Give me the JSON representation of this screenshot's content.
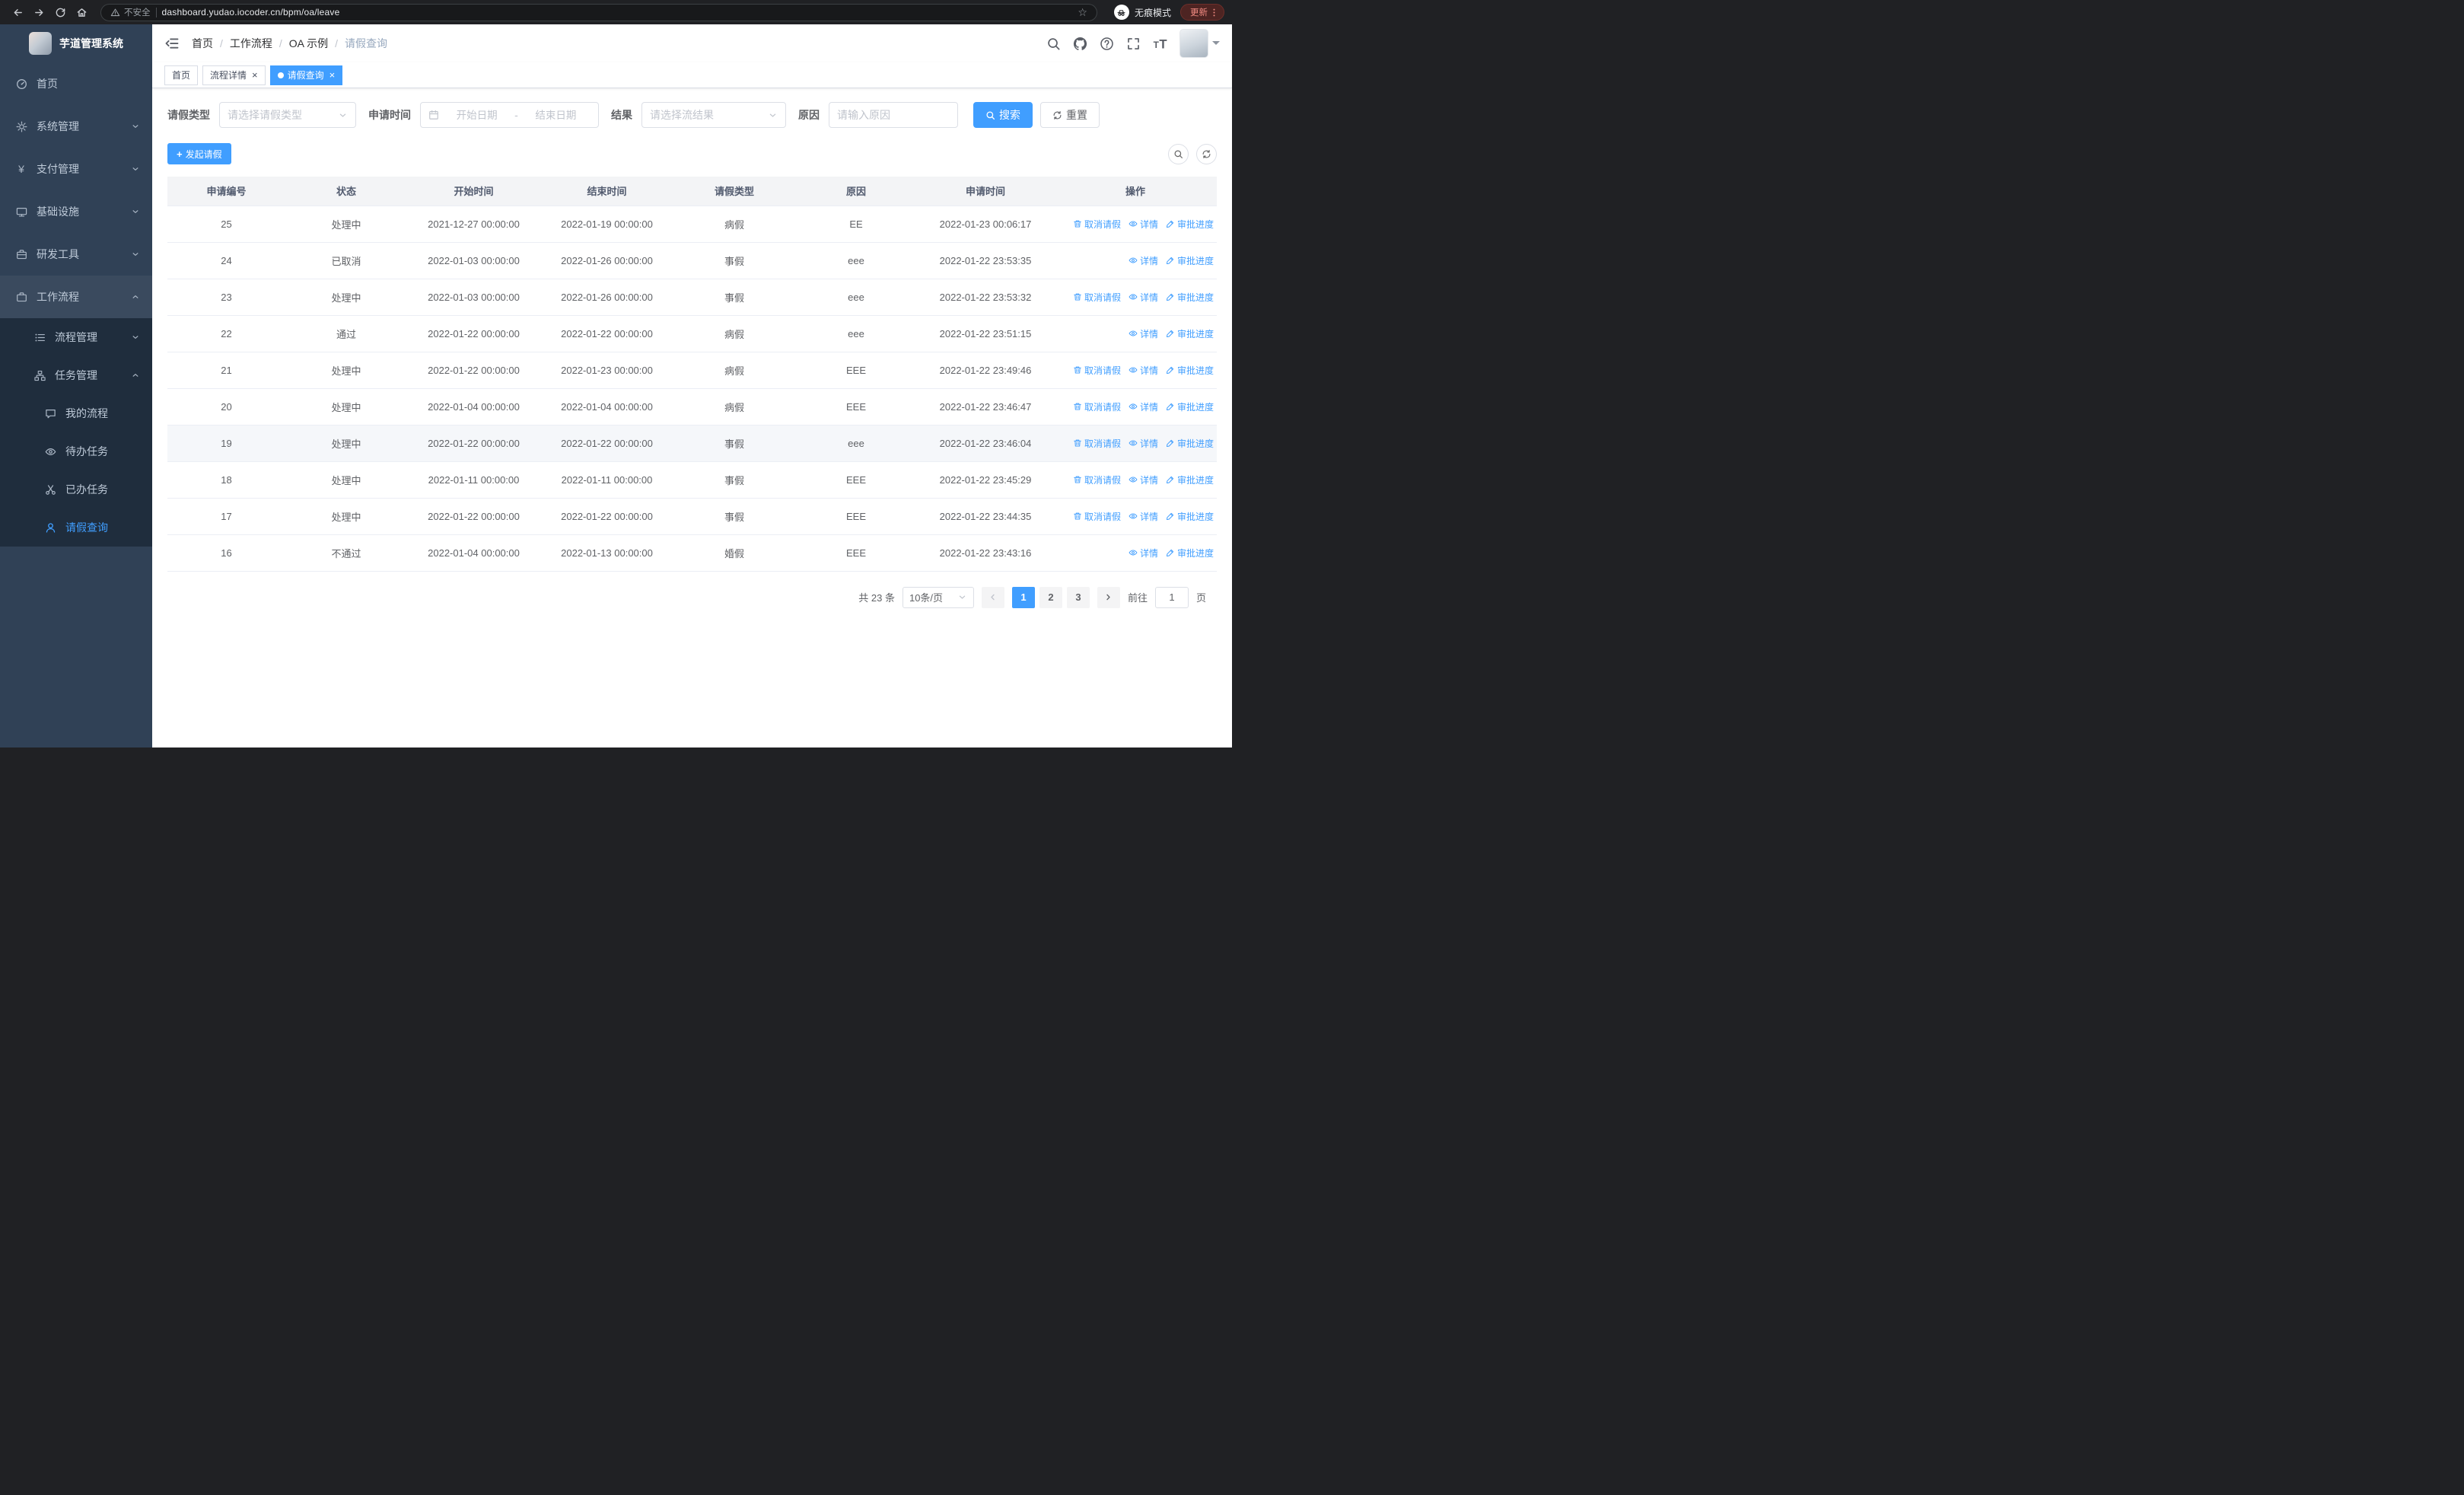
{
  "browser": {
    "security_warning": "不安全",
    "url": "dashboard.yudao.iocoder.cn/bpm/oa/leave",
    "incognito_label": "无痕模式",
    "update_button": "更新"
  },
  "icons": {
    "close": "×",
    "plus": "+",
    "star": "☆",
    "yen": "¥"
  },
  "sidebar": {
    "logo_title": "芋道管理系统",
    "items": [
      {
        "label": "首页",
        "icon": "dashboard-icon"
      },
      {
        "label": "系统管理",
        "icon": "gear-icon"
      },
      {
        "label": "支付管理",
        "icon": "yen-icon"
      },
      {
        "label": "基础设施",
        "icon": "monitor-icon"
      },
      {
        "label": "研发工具",
        "icon": "briefcase-icon"
      },
      {
        "label": "工作流程",
        "icon": "workflow-icon",
        "expanded": true
      }
    ],
    "workflow_children": [
      {
        "label": "流程管理",
        "icon": "list-icon"
      },
      {
        "label": "任务管理",
        "icon": "tree-icon",
        "expanded": true
      }
    ],
    "task_children": [
      {
        "label": "我的流程",
        "icon": "message-icon"
      },
      {
        "label": "待办任务",
        "icon": "eye-icon"
      },
      {
        "label": "已办任务",
        "icon": "scissors-icon"
      },
      {
        "label": "请假查询",
        "icon": "user-icon",
        "active": true
      }
    ]
  },
  "header": {
    "breadcrumb": [
      "首页",
      "工作流程",
      "OA 示例",
      "请假查询"
    ],
    "crumb_separator": "/",
    "icons": [
      "search-icon",
      "github-icon",
      "help-icon",
      "fullscreen-icon",
      "font-size-icon"
    ]
  },
  "tabs": [
    {
      "label": "首页",
      "closable": false,
      "active": false
    },
    {
      "label": "流程详情",
      "closable": true,
      "active": false
    },
    {
      "label": "请假查询",
      "closable": true,
      "active": true
    }
  ],
  "filters": {
    "leave_type_label": "请假类型",
    "leave_type_placeholder": "请选择请假类型",
    "apply_time_label": "申请时间",
    "start_date_placeholder": "开始日期",
    "date_separator": "-",
    "end_date_placeholder": "结束日期",
    "result_label": "结果",
    "result_placeholder": "请选择流结果",
    "reason_label": "原因",
    "reason_placeholder": "请输入原因",
    "search_button": "搜索",
    "reset_button": "重置"
  },
  "toolbar": {
    "create_button": "发起请假"
  },
  "table": {
    "columns": [
      "申请编号",
      "状态",
      "开始时间",
      "结束时间",
      "请假类型",
      "原因",
      "申请时间",
      "操作"
    ],
    "action_cancel": "取消请假",
    "action_detail": "详情",
    "action_progress": "审批进度",
    "rows": [
      {
        "id": "25",
        "status": "处理中",
        "start": "2021-12-27 00:00:00",
        "end": "2022-01-19 00:00:00",
        "type": "病假",
        "reason": "EE",
        "apply_time": "2022-01-23 00:06:17",
        "cancellable": true
      },
      {
        "id": "24",
        "status": "已取消",
        "start": "2022-01-03 00:00:00",
        "end": "2022-01-26 00:00:00",
        "type": "事假",
        "reason": "eee",
        "apply_time": "2022-01-22 23:53:35",
        "cancellable": false
      },
      {
        "id": "23",
        "status": "处理中",
        "start": "2022-01-03 00:00:00",
        "end": "2022-01-26 00:00:00",
        "type": "事假",
        "reason": "eee",
        "apply_time": "2022-01-22 23:53:32",
        "cancellable": true
      },
      {
        "id": "22",
        "status": "通过",
        "start": "2022-01-22 00:00:00",
        "end": "2022-01-22 00:00:00",
        "type": "病假",
        "reason": "eee",
        "apply_time": "2022-01-22 23:51:15",
        "cancellable": false
      },
      {
        "id": "21",
        "status": "处理中",
        "start": "2022-01-22 00:00:00",
        "end": "2022-01-23 00:00:00",
        "type": "病假",
        "reason": "EEE",
        "apply_time": "2022-01-22 23:49:46",
        "cancellable": true
      },
      {
        "id": "20",
        "status": "处理中",
        "start": "2022-01-04 00:00:00",
        "end": "2022-01-04 00:00:00",
        "type": "病假",
        "reason": "EEE",
        "apply_time": "2022-01-22 23:46:47",
        "cancellable": true
      },
      {
        "id": "19",
        "status": "处理中",
        "start": "2022-01-22 00:00:00",
        "end": "2022-01-22 00:00:00",
        "type": "事假",
        "reason": "eee",
        "apply_time": "2022-01-22 23:46:04",
        "cancellable": true,
        "hover": true
      },
      {
        "id": "18",
        "status": "处理中",
        "start": "2022-01-11 00:00:00",
        "end": "2022-01-11 00:00:00",
        "type": "事假",
        "reason": "EEE",
        "apply_time": "2022-01-22 23:45:29",
        "cancellable": true
      },
      {
        "id": "17",
        "status": "处理中",
        "start": "2022-01-22 00:00:00",
        "end": "2022-01-22 00:00:00",
        "type": "事假",
        "reason": "EEE",
        "apply_time": "2022-01-22 23:44:35",
        "cancellable": true
      },
      {
        "id": "16",
        "status": "不通过",
        "start": "2022-01-04 00:00:00",
        "end": "2022-01-13 00:00:00",
        "type": "婚假",
        "reason": "EEE",
        "apply_time": "2022-01-22 23:43:16",
        "cancellable": false
      }
    ]
  },
  "pagination": {
    "total_text": "共 23 条",
    "page_size": "10条/页",
    "pages": [
      "1",
      "2",
      "3"
    ],
    "current_page": "1",
    "goto_label": "前往",
    "goto_value": "1",
    "goto_suffix": "页"
  },
  "colors": {
    "primary": "#409eff",
    "sidebar_bg": "#304156",
    "submenu_bg": "#1f2d3d",
    "table_border": "#ebeef5",
    "update_badge": "#f28b82"
  }
}
